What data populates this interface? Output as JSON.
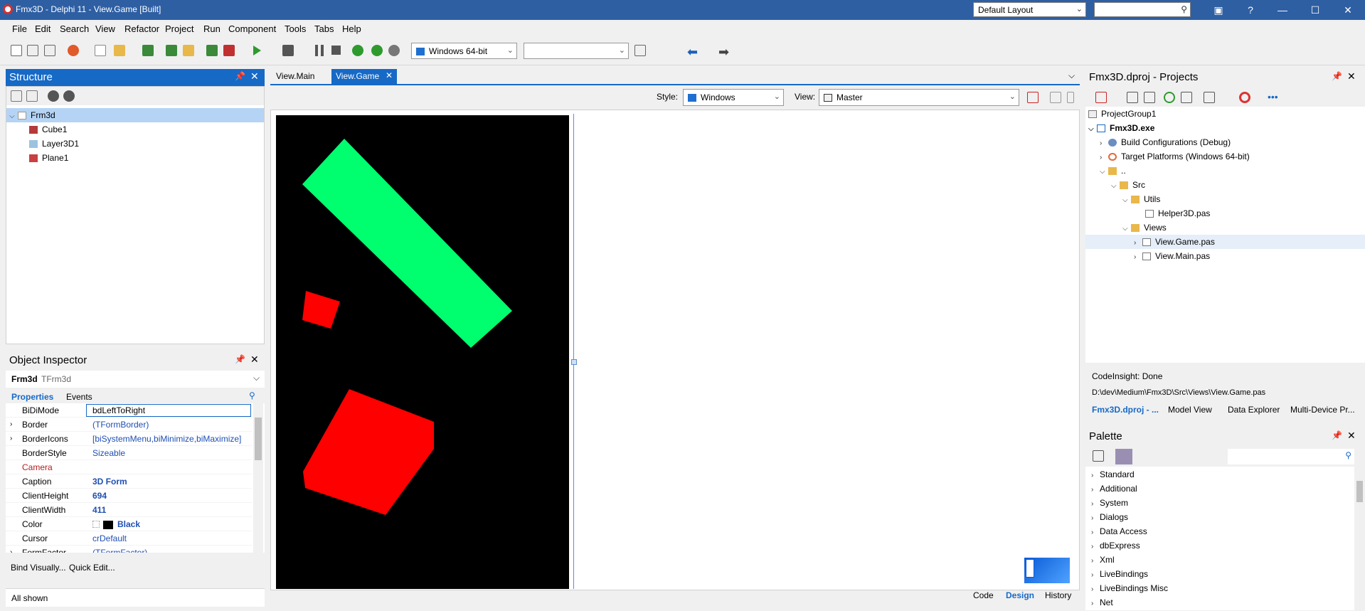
{
  "window": {
    "title": "Fmx3D - Delphi 11 - View.Game [Built]",
    "layout_combo": "Default Layout",
    "search_placeholder": "",
    "min_symbol": "—",
    "max_symbol": "☐",
    "close_symbol": "✕",
    "help_symbol": "?"
  },
  "menu": [
    "File",
    "Edit",
    "Search",
    "View",
    "Refactor",
    "Project",
    "Run",
    "Component",
    "Tools",
    "Tabs",
    "Help"
  ],
  "toolbar": {
    "platform": "Windows 64-bit",
    "config": ""
  },
  "structure": {
    "title": "Structure",
    "root": "Frm3d",
    "items": [
      "Cube1",
      "Layer3D1",
      "Plane1"
    ]
  },
  "inspector": {
    "title": "Object Inspector",
    "object_name": "Frm3d",
    "object_type": "TFrm3d",
    "tab_properties": "Properties",
    "tab_events": "Events",
    "rows": [
      {
        "name": "BiDiMode",
        "value": "bdLeftToRight"
      },
      {
        "name": "Border",
        "value": "(TFormBorder)"
      },
      {
        "name": "BorderIcons",
        "value": "[biSystemMenu,biMinimize,biMaximize]"
      },
      {
        "name": "BorderStyle",
        "value": "Sizeable"
      },
      {
        "name": "Camera",
        "value": ""
      },
      {
        "name": "Caption",
        "value": "3D Form"
      },
      {
        "name": "ClientHeight",
        "value": "694"
      },
      {
        "name": "ClientWidth",
        "value": "411"
      },
      {
        "name": "Color",
        "value": "Black"
      },
      {
        "name": "Cursor",
        "value": "crDefault"
      },
      {
        "name": "FormFactor",
        "value": "(TFormFactor)"
      }
    ],
    "bind_visually": "Bind Visually...",
    "quick_edit": "Quick Edit...",
    "status": "All shown"
  },
  "editor": {
    "tabs": [
      "View.Main",
      "View.Game"
    ],
    "style_label": "Style:",
    "style_value": "Windows",
    "view_label": "View:",
    "view_value": "Master",
    "bottom_tabs": [
      "Code",
      "Design",
      "History"
    ]
  },
  "projects": {
    "title": "Fmx3D.dproj - Projects",
    "group": "ProjectGroup1",
    "exe": "Fmx3D.exe",
    "build_cfg": "Build Configurations (Debug)",
    "target": "Target Platforms (Windows 64-bit)",
    "dotdot": "..",
    "src": "Src",
    "utils": "Utils",
    "helper": "Helper3D.pas",
    "views": "Views",
    "game": "View.Game.pas",
    "main": "View.Main.pas",
    "codeinsight": "CodeInsight: Done",
    "path": "D:\\dev\\Medium\\Fmx3D\\Src\\Views\\View.Game.pas",
    "tabs": [
      "Fmx3D.dproj - ...",
      "Model View",
      "Data Explorer",
      "Multi-Device Pr..."
    ]
  },
  "palette": {
    "title": "Palette",
    "categories": [
      "Standard",
      "Additional",
      "System",
      "Dialogs",
      "Data Access",
      "dbExpress",
      "Xml",
      "LiveBindings",
      "LiveBindings Misc",
      "Net"
    ]
  },
  "colors": {
    "accent": "#1769c6",
    "titlebar": "#2e5fa3",
    "green_shape": "#00ff6e",
    "red_shape": "#ff0000",
    "canvas": "#000000"
  }
}
